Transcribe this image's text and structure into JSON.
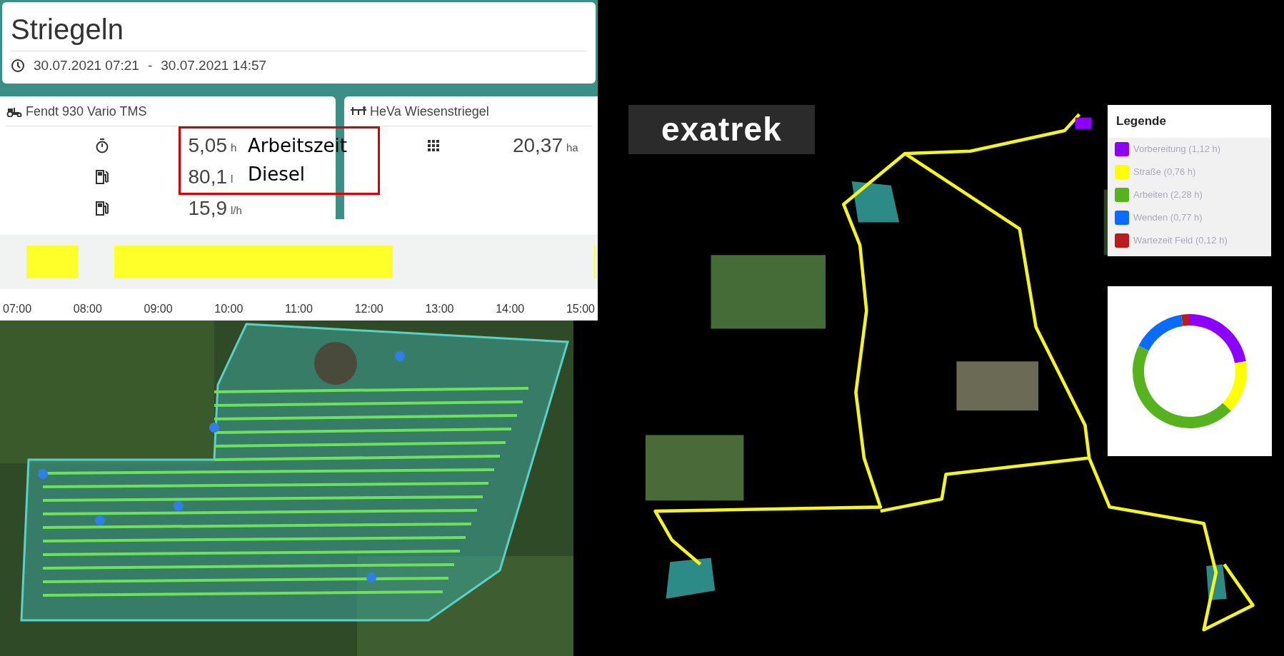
{
  "header": {
    "title": "Striegeln",
    "start": "30.07.2021 07:21",
    "separator": "-",
    "end": "30.07.2021 14:57"
  },
  "machines": [
    {
      "name": "Fendt 930 Vario TMS",
      "kind": "tractor",
      "metrics": [
        {
          "kind": "stopwatch",
          "value": "5,05",
          "unit": "h"
        },
        {
          "kind": "fuel",
          "value": "80,1",
          "unit": "l"
        },
        {
          "kind": "fuel",
          "value": "15,9",
          "unit": "l/h"
        }
      ]
    },
    {
      "name": "HeVa Wiesenstriegel",
      "kind": "implement",
      "metrics": [
        {
          "kind": "grid",
          "value": "20,37",
          "unit": "ha"
        }
      ]
    }
  ],
  "annotation": {
    "labels": [
      "Arbeitszeit",
      "Diesel"
    ]
  },
  "timeline": {
    "ticks": [
      "07:00",
      "08:00",
      "09:00",
      "10:00",
      "11:00",
      "12:00",
      "13:00",
      "14:00",
      "15:00"
    ]
  },
  "route_map": {
    "logo": "exatrek",
    "legend": {
      "title": "Legende",
      "items": [
        {
          "label": "Vorbereitung (1,12 h)",
          "color": "#8b00ff"
        },
        {
          "label": "Straße (0,76 h)",
          "color": "#ffff00"
        },
        {
          "label": "Arbeiten (2,28 h)",
          "color": "#56b31d"
        },
        {
          "label": "Wenden (0,77 h)",
          "color": "#0a6cff"
        },
        {
          "label": "Wartezeit Feld (0,12 h)",
          "color": "#b81c1c"
        }
      ]
    },
    "chart_data": {
      "type": "donut",
      "values": [
        22.2,
        15.0,
        45.2,
        15.2,
        2.4
      ]
    }
  }
}
